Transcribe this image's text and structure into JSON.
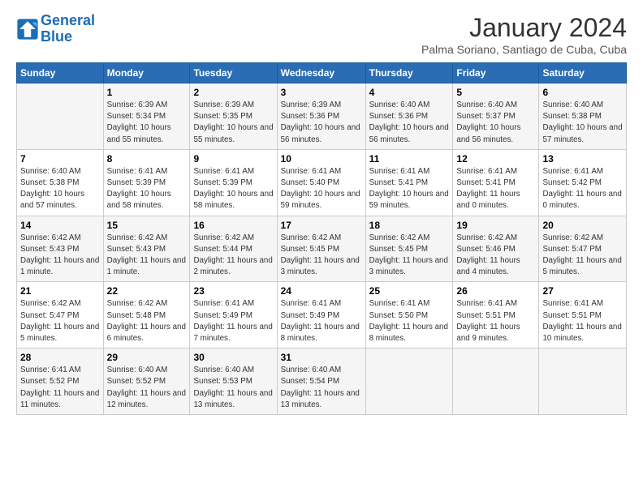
{
  "logo": {
    "line1": "General",
    "line2": "Blue"
  },
  "title": "January 2024",
  "subtitle": "Palma Soriano, Santiago de Cuba, Cuba",
  "headers": [
    "Sunday",
    "Monday",
    "Tuesday",
    "Wednesday",
    "Thursday",
    "Friday",
    "Saturday"
  ],
  "weeks": [
    [
      {
        "day": "",
        "sunrise": "",
        "sunset": "",
        "daylight": ""
      },
      {
        "day": "1",
        "sunrise": "Sunrise: 6:39 AM",
        "sunset": "Sunset: 5:34 PM",
        "daylight": "Daylight: 10 hours and 55 minutes."
      },
      {
        "day": "2",
        "sunrise": "Sunrise: 6:39 AM",
        "sunset": "Sunset: 5:35 PM",
        "daylight": "Daylight: 10 hours and 55 minutes."
      },
      {
        "day": "3",
        "sunrise": "Sunrise: 6:39 AM",
        "sunset": "Sunset: 5:36 PM",
        "daylight": "Daylight: 10 hours and 56 minutes."
      },
      {
        "day": "4",
        "sunrise": "Sunrise: 6:40 AM",
        "sunset": "Sunset: 5:36 PM",
        "daylight": "Daylight: 10 hours and 56 minutes."
      },
      {
        "day": "5",
        "sunrise": "Sunrise: 6:40 AM",
        "sunset": "Sunset: 5:37 PM",
        "daylight": "Daylight: 10 hours and 56 minutes."
      },
      {
        "day": "6",
        "sunrise": "Sunrise: 6:40 AM",
        "sunset": "Sunset: 5:38 PM",
        "daylight": "Daylight: 10 hours and 57 minutes."
      }
    ],
    [
      {
        "day": "7",
        "sunrise": "Sunrise: 6:40 AM",
        "sunset": "Sunset: 5:38 PM",
        "daylight": "Daylight: 10 hours and 57 minutes."
      },
      {
        "day": "8",
        "sunrise": "Sunrise: 6:41 AM",
        "sunset": "Sunset: 5:39 PM",
        "daylight": "Daylight: 10 hours and 58 minutes."
      },
      {
        "day": "9",
        "sunrise": "Sunrise: 6:41 AM",
        "sunset": "Sunset: 5:39 PM",
        "daylight": "Daylight: 10 hours and 58 minutes."
      },
      {
        "day": "10",
        "sunrise": "Sunrise: 6:41 AM",
        "sunset": "Sunset: 5:40 PM",
        "daylight": "Daylight: 10 hours and 59 minutes."
      },
      {
        "day": "11",
        "sunrise": "Sunrise: 6:41 AM",
        "sunset": "Sunset: 5:41 PM",
        "daylight": "Daylight: 10 hours and 59 minutes."
      },
      {
        "day": "12",
        "sunrise": "Sunrise: 6:41 AM",
        "sunset": "Sunset: 5:41 PM",
        "daylight": "Daylight: 11 hours and 0 minutes."
      },
      {
        "day": "13",
        "sunrise": "Sunrise: 6:41 AM",
        "sunset": "Sunset: 5:42 PM",
        "daylight": "Daylight: 11 hours and 0 minutes."
      }
    ],
    [
      {
        "day": "14",
        "sunrise": "Sunrise: 6:42 AM",
        "sunset": "Sunset: 5:43 PM",
        "daylight": "Daylight: 11 hours and 1 minute."
      },
      {
        "day": "15",
        "sunrise": "Sunrise: 6:42 AM",
        "sunset": "Sunset: 5:43 PM",
        "daylight": "Daylight: 11 hours and 1 minute."
      },
      {
        "day": "16",
        "sunrise": "Sunrise: 6:42 AM",
        "sunset": "Sunset: 5:44 PM",
        "daylight": "Daylight: 11 hours and 2 minutes."
      },
      {
        "day": "17",
        "sunrise": "Sunrise: 6:42 AM",
        "sunset": "Sunset: 5:45 PM",
        "daylight": "Daylight: 11 hours and 3 minutes."
      },
      {
        "day": "18",
        "sunrise": "Sunrise: 6:42 AM",
        "sunset": "Sunset: 5:45 PM",
        "daylight": "Daylight: 11 hours and 3 minutes."
      },
      {
        "day": "19",
        "sunrise": "Sunrise: 6:42 AM",
        "sunset": "Sunset: 5:46 PM",
        "daylight": "Daylight: 11 hours and 4 minutes."
      },
      {
        "day": "20",
        "sunrise": "Sunrise: 6:42 AM",
        "sunset": "Sunset: 5:47 PM",
        "daylight": "Daylight: 11 hours and 5 minutes."
      }
    ],
    [
      {
        "day": "21",
        "sunrise": "Sunrise: 6:42 AM",
        "sunset": "Sunset: 5:47 PM",
        "daylight": "Daylight: 11 hours and 5 minutes."
      },
      {
        "day": "22",
        "sunrise": "Sunrise: 6:42 AM",
        "sunset": "Sunset: 5:48 PM",
        "daylight": "Daylight: 11 hours and 6 minutes."
      },
      {
        "day": "23",
        "sunrise": "Sunrise: 6:41 AM",
        "sunset": "Sunset: 5:49 PM",
        "daylight": "Daylight: 11 hours and 7 minutes."
      },
      {
        "day": "24",
        "sunrise": "Sunrise: 6:41 AM",
        "sunset": "Sunset: 5:49 PM",
        "daylight": "Daylight: 11 hours and 8 minutes."
      },
      {
        "day": "25",
        "sunrise": "Sunrise: 6:41 AM",
        "sunset": "Sunset: 5:50 PM",
        "daylight": "Daylight: 11 hours and 8 minutes."
      },
      {
        "day": "26",
        "sunrise": "Sunrise: 6:41 AM",
        "sunset": "Sunset: 5:51 PM",
        "daylight": "Daylight: 11 hours and 9 minutes."
      },
      {
        "day": "27",
        "sunrise": "Sunrise: 6:41 AM",
        "sunset": "Sunset: 5:51 PM",
        "daylight": "Daylight: 11 hours and 10 minutes."
      }
    ],
    [
      {
        "day": "28",
        "sunrise": "Sunrise: 6:41 AM",
        "sunset": "Sunset: 5:52 PM",
        "daylight": "Daylight: 11 hours and 11 minutes."
      },
      {
        "day": "29",
        "sunrise": "Sunrise: 6:40 AM",
        "sunset": "Sunset: 5:52 PM",
        "daylight": "Daylight: 11 hours and 12 minutes."
      },
      {
        "day": "30",
        "sunrise": "Sunrise: 6:40 AM",
        "sunset": "Sunset: 5:53 PM",
        "daylight": "Daylight: 11 hours and 13 minutes."
      },
      {
        "day": "31",
        "sunrise": "Sunrise: 6:40 AM",
        "sunset": "Sunset: 5:54 PM",
        "daylight": "Daylight: 11 hours and 13 minutes."
      },
      {
        "day": "",
        "sunrise": "",
        "sunset": "",
        "daylight": ""
      },
      {
        "day": "",
        "sunrise": "",
        "sunset": "",
        "daylight": ""
      },
      {
        "day": "",
        "sunrise": "",
        "sunset": "",
        "daylight": ""
      }
    ]
  ]
}
